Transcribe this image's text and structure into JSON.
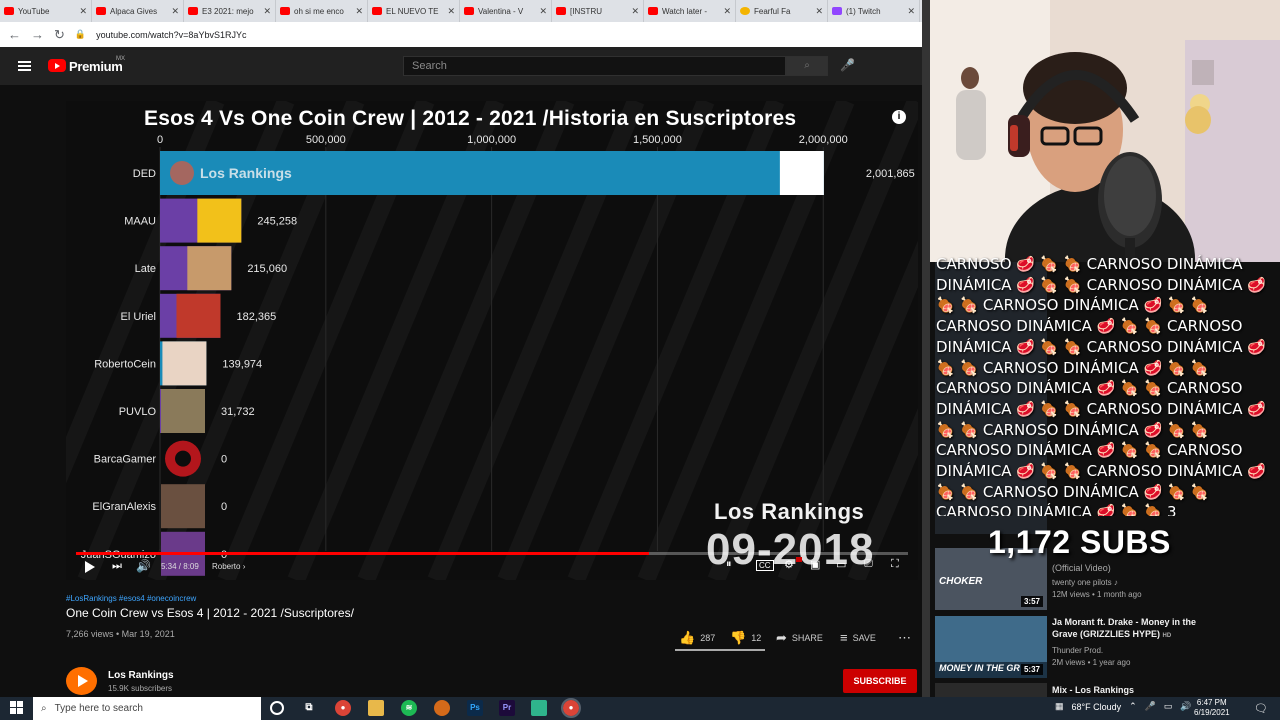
{
  "browser": {
    "tabs": [
      {
        "label": "YouTube",
        "icon": "youtube-icon"
      },
      {
        "label": "Alpaca Gives",
        "icon": "youtube-icon"
      },
      {
        "label": "E3 2021: mejo",
        "icon": "youtube-icon"
      },
      {
        "label": "oh si me enco",
        "icon": "youtube-icon"
      },
      {
        "label": "EL NUEVO TE",
        "icon": "youtube-icon"
      },
      {
        "label": "Valentina - V",
        "icon": "youtube-icon"
      },
      {
        "label": "[INSTRU",
        "icon": "youtube-icon"
      },
      {
        "label": "Watch later -",
        "icon": "youtube-icon"
      },
      {
        "label": "Fearful Fa",
        "icon": "emoji-icon"
      },
      {
        "label": "(1) Twitch",
        "icon": "twitch-icon"
      }
    ],
    "url": "youtube.com/watch?v=8aYbvS1RJYc"
  },
  "youtube": {
    "brand": "Premium",
    "brand_region": "MX",
    "search_placeholder": "Search"
  },
  "player": {
    "title": "Esos 4  Vs One Coin  Crew  |  2012 - 2021 /Historia en Suscriptores",
    "watermark_name": "Los Rankings",
    "watermark_date": "09-2018",
    "time": "5:34 / 8:09",
    "chapter": "Roberto",
    "progress": 0.689
  },
  "chart_data": {
    "type": "bar",
    "orientation": "horizontal",
    "title": "Esos 4  Vs One Coin  Crew  |  2012 - 2021 /Historia en Suscriptores",
    "xticks": [
      0,
      500000,
      1000000,
      1500000,
      2000000
    ],
    "xtick_labels": [
      "0",
      "500,000",
      "1,000,000",
      "1,500,000",
      "2,000,000"
    ],
    "xlim": [
      0,
      2150000
    ],
    "categories": [
      "DED",
      "MAAU",
      "Late",
      "El Uriel",
      "RobertoCein",
      "PUVLO",
      "BarcaGamer",
      "ElGranAlexis",
      "JuanSGuamizo"
    ],
    "values": [
      2001865,
      245258,
      215060,
      182365,
      139974,
      31732,
      0,
      0,
      0
    ],
    "value_labels": [
      "2,001,865",
      "245,258",
      "215,060",
      "182,365",
      "139,974",
      "31,732",
      "0",
      "0",
      "0"
    ],
    "bar_inner_label": "Los Rankings",
    "colors": [
      "#1a8bb8",
      "#6b3fa6",
      "#6b3fa6",
      "#6b3fa6",
      "#1a8bb8",
      "#6b3fa6",
      "#6b3fa6",
      "#6b3fa6",
      "#6b3fa6"
    ]
  },
  "video": {
    "hashtags": "#LosRankings #esos4 #onecoincrew",
    "title": "One Coin Crew vs Esos 4 | 2012 - 2021 /Suscriptores/",
    "meta": "7,266 views • Mar 19, 2021",
    "likes": "287",
    "dislikes": "12",
    "share": "SHARE",
    "save": "SAVE"
  },
  "channel": {
    "name": "Los Rankings",
    "subs": "15.9K subscribers",
    "subscribe": "SUBSCRIBE"
  },
  "chat": {
    "text": "CARNOSO DINÁMICA",
    "tail": "3",
    "subs_counter": "1,172 SUBS"
  },
  "recommended": [
    {
      "title": "",
      "channel": "twenty one pilots ♪",
      "meta": "12M views • 1 month ago",
      "duration": "3:57",
      "thumb_label": "CHOKER"
    },
    {
      "title": "Ja Morant ft. Drake - Money in the Grave (GRIZZLIES HYPE)",
      "channel": "Thunder Prod.",
      "meta": "2M views • 1 year ago",
      "duration": "5:37",
      "thumb_label": "MONEY IN THE GR"
    },
    {
      "title": "Mix - Los Rankings",
      "channel": "",
      "meta": "",
      "duration": "",
      "thumb_label": ""
    }
  ],
  "rec_partial_above": "(Official Video)",
  "rec_badge": "HD",
  "taskbar": {
    "search_placeholder": "Type here to search",
    "weather": "68°F  Cloudy",
    "time": "6:47 PM",
    "date": "6/19/2021"
  }
}
